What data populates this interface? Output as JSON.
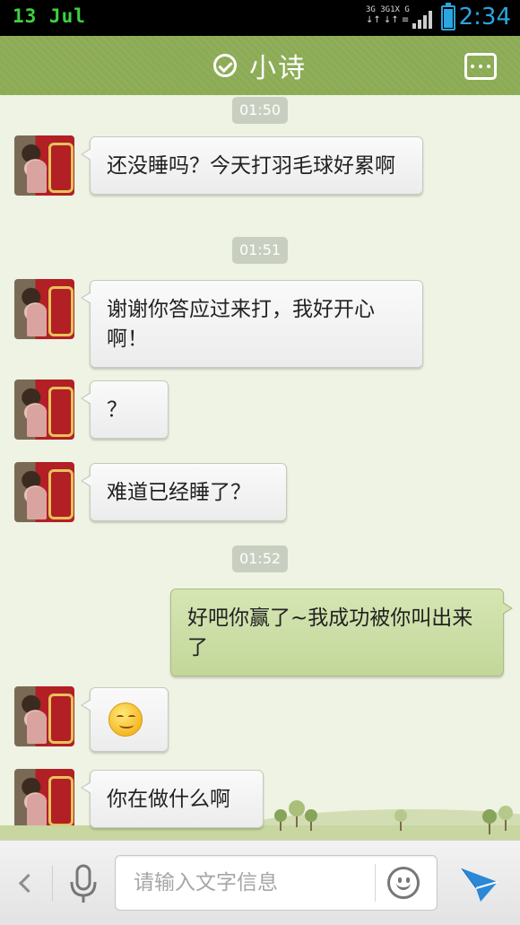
{
  "status_bar": {
    "date": "13 Jul",
    "network_top": "3G 3G1X G",
    "time": "2:34",
    "colors": {
      "date": "#3fd13f",
      "time": "#2aa6e0"
    }
  },
  "header": {
    "title": "小诗",
    "status_icon": "check-circle-icon",
    "menu_icon": "more-icon",
    "color": "#8cab55"
  },
  "messages": [
    {
      "type": "time",
      "text": "01:50"
    },
    {
      "type": "in",
      "text": "还没睡吗？今天打羽毛球好累啊"
    },
    {
      "type": "time",
      "text": "01:51"
    },
    {
      "type": "in",
      "text": "谢谢你答应过来打，我好开心啊！"
    },
    {
      "type": "in",
      "text": "？"
    },
    {
      "type": "in",
      "text": "难道已经睡了？"
    },
    {
      "type": "time",
      "text": "01:52"
    },
    {
      "type": "out",
      "text": "好吧你赢了~我成功被你叫出来了"
    },
    {
      "type": "in",
      "emoji": "smiley-emoji"
    },
    {
      "type": "in",
      "text": "你在做什么啊"
    }
  ],
  "input_bar": {
    "placeholder": "请输入文字信息",
    "value": "",
    "icons": [
      "chevron-left-icon",
      "microphone-icon",
      "emoji-icon",
      "send-icon"
    ],
    "send_color": "#2a88d6"
  }
}
